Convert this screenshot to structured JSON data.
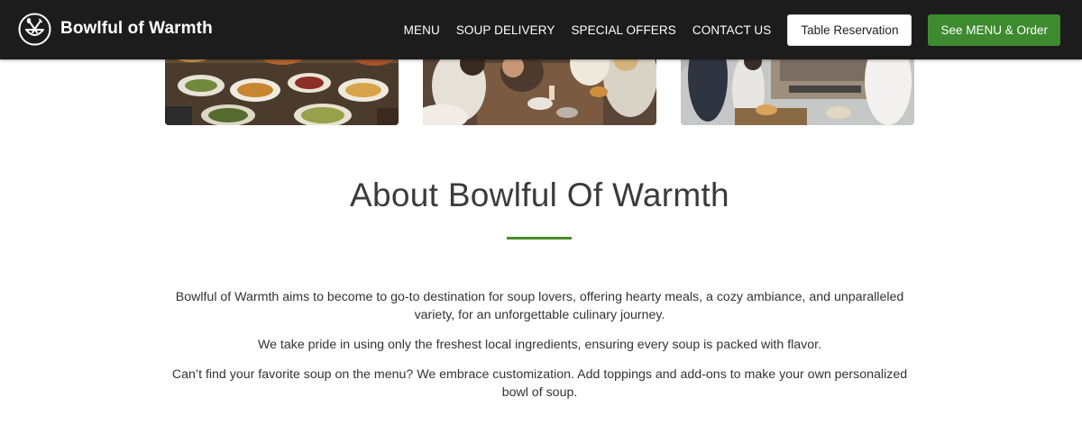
{
  "brand": {
    "name": "Bowlful of Warmth",
    "logo_icon": "bowl-spoon-fork-icon"
  },
  "nav": {
    "items": [
      "MENU",
      "SOUP DELIVERY",
      "SPECIAL OFFERS",
      "CONTACT US"
    ],
    "reservation_label": "Table Reservation",
    "order_label": "See MENU & Order"
  },
  "photos": [
    {
      "subject": "buffet-food-photo"
    },
    {
      "subject": "diners-at-table-photo"
    },
    {
      "subject": "kitchen-staff-photo"
    }
  ],
  "about": {
    "title": "About Bowlful Of Warmth",
    "paragraphs": [
      "Bowlful of Warmth aims to become to go-to destination for soup lovers, offering hearty meals, a cozy ambiance, and unparalleled variety, for an unforgettable culinary journey.",
      "We take pride in using only the freshest local ingredients, ensuring every soup is packed with flavor.",
      "Can’t find your favorite soup on the menu? We embrace customization. Add toppings and add-ons to make your own personalized bowl of soup."
    ]
  },
  "colors": {
    "header_bg": "#1c1c1c",
    "accent_green": "#3d8a2f",
    "title_text": "#3b3b3b"
  }
}
